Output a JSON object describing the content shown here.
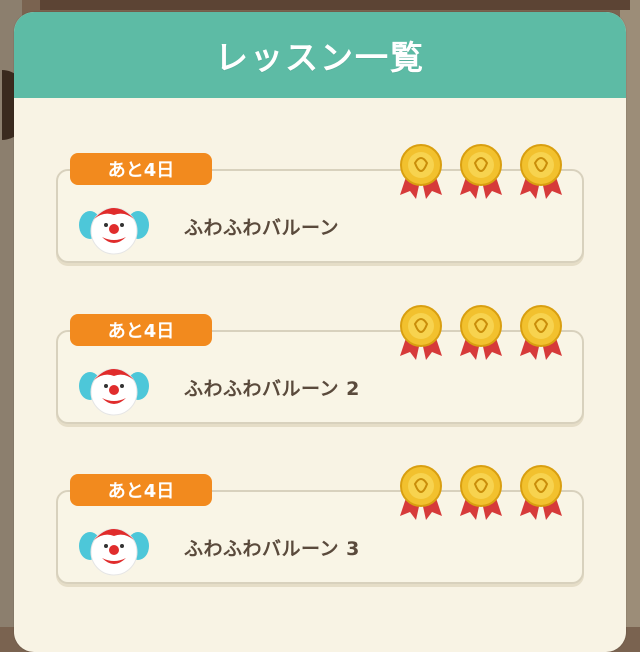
{
  "header": {
    "title": "レッスン一覧"
  },
  "lessons": [
    {
      "days_left": "あと4日",
      "name": "ふわふわバルーン",
      "medals": 3,
      "character": "clown-icon"
    },
    {
      "days_left": "あと4日",
      "name": "ふわふわバルーン 2",
      "medals": 3,
      "character": "clown-icon"
    },
    {
      "days_left": "あと4日",
      "name": "ふわふわバルーン 3",
      "medals": 3,
      "character": "clown-icon"
    }
  ],
  "colors": {
    "header": "#5dbba5",
    "badge": "#f28a1e",
    "panel": "#f8f3e4",
    "medal_gold": "#f2c12e",
    "ribbon": "#d63a3a"
  }
}
